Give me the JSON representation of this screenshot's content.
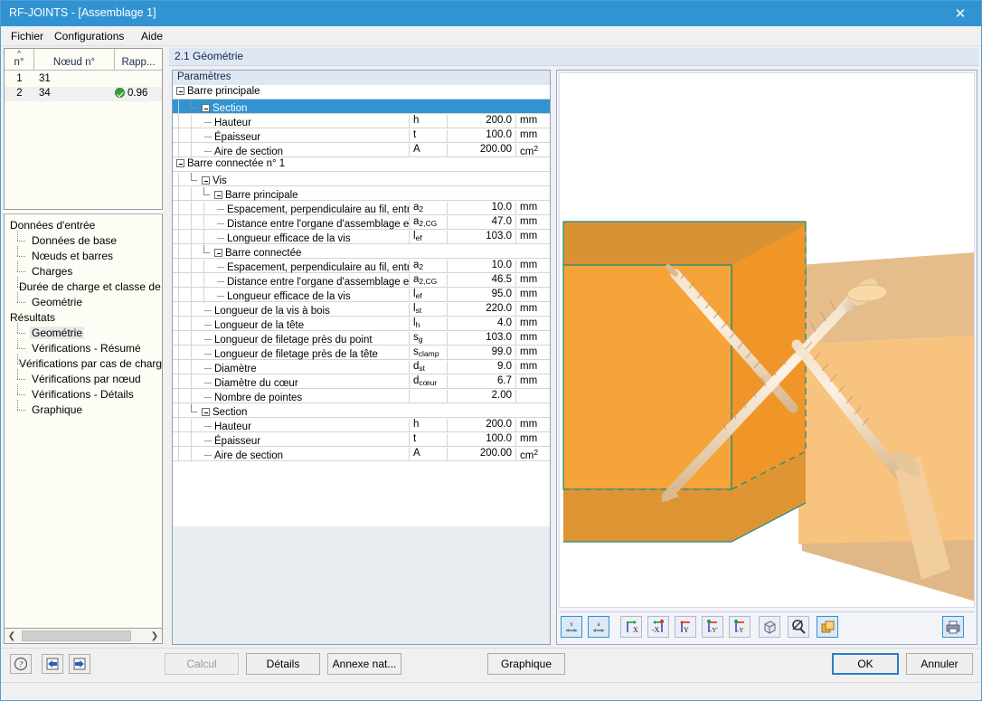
{
  "window": {
    "title": "RF-JOINTS - [Assemblage 1]",
    "close_icon": "close-icon",
    "titlebar_color": "#3193d2"
  },
  "menu": {
    "items": [
      {
        "label": "Fichier"
      },
      {
        "label": "Configurations"
      },
      {
        "label": "Aide"
      }
    ]
  },
  "grid": {
    "columns": [
      {
        "label": "n°"
      },
      {
        "label": "Nœud n°"
      },
      {
        "label": "Rapp..."
      }
    ],
    "rows": [
      {
        "n": "1",
        "node": "31",
        "ratio": "",
        "has_check": false
      },
      {
        "n": "2",
        "node": "34",
        "ratio": "0.96",
        "has_check": true
      }
    ]
  },
  "tree": {
    "sections": [
      {
        "label": "Données d'entrée",
        "items": [
          {
            "label": "Données de base"
          },
          {
            "label": "Nœuds et barres"
          },
          {
            "label": "Charges"
          },
          {
            "label": "Durée de charge et classe de s"
          },
          {
            "label": "Geométrie"
          }
        ]
      },
      {
        "label": "Résultats",
        "items": [
          {
            "label": "Geométrie",
            "selected": true
          },
          {
            "label": "Vérifications - Résumé"
          },
          {
            "label": "Vérifications par cas de charge"
          },
          {
            "label": "Vérifications par nœud"
          },
          {
            "label": "Vérifications - Détails"
          },
          {
            "label": "Graphique"
          }
        ]
      }
    ]
  },
  "section_header": {
    "title": "2.1 Géométrie"
  },
  "params": {
    "header": "Paramètres",
    "rows": [
      {
        "type": "group",
        "depth": 0,
        "label": "Barre principale",
        "expander": true
      },
      {
        "type": "group",
        "depth": 1,
        "label": "Section",
        "expander": true,
        "selected": true
      },
      {
        "type": "row",
        "depth": 2,
        "label": "Hauteur",
        "sym": "h",
        "sym_sub": "",
        "value": "200.0",
        "unit": "mm",
        "unit_sup": ""
      },
      {
        "type": "row",
        "depth": 2,
        "label": "Épaisseur",
        "sym": "t",
        "sym_sub": "",
        "value": "100.0",
        "unit": "mm",
        "unit_sup": ""
      },
      {
        "type": "row",
        "depth": 2,
        "label": "Aire de section",
        "sym": "A",
        "sym_sub": "",
        "value": "200.00",
        "unit": "cm",
        "unit_sup": "2"
      },
      {
        "type": "group",
        "depth": 0,
        "label": "Barre connectée n° 1",
        "expander": true
      },
      {
        "type": "group",
        "depth": 1,
        "label": "Vis",
        "expander": true
      },
      {
        "type": "group",
        "depth": 2,
        "label": "Barre principale",
        "expander": true
      },
      {
        "type": "row",
        "depth": 3,
        "label": "Espacement, perpendiculaire au fil, entre les",
        "sym": "a",
        "sym_sub": "2",
        "value": "10.0",
        "unit": "mm",
        "unit_sup": ""
      },
      {
        "type": "row",
        "depth": 3,
        "label": "Distance entre l'organe d'assemblage et le b",
        "sym": "a",
        "sym_sub": "2,CG",
        "value": "47.0",
        "unit": "mm",
        "unit_sup": ""
      },
      {
        "type": "row",
        "depth": 3,
        "label": "Longueur efficace de la vis",
        "sym": "l",
        "sym_sub": "ef",
        "value": "103.0",
        "unit": "mm",
        "unit_sup": ""
      },
      {
        "type": "group",
        "depth": 2,
        "label": "Barre connectée",
        "expander": true
      },
      {
        "type": "row",
        "depth": 3,
        "label": "Espacement, perpendiculaire au fil, entre les",
        "sym": "a",
        "sym_sub": "2",
        "value": "10.0",
        "unit": "mm",
        "unit_sup": ""
      },
      {
        "type": "row",
        "depth": 3,
        "label": "Distance entre l'organe d'assemblage et le b",
        "sym": "a",
        "sym_sub": "2,CG",
        "value": "46.5",
        "unit": "mm",
        "unit_sup": ""
      },
      {
        "type": "row",
        "depth": 3,
        "label": "Longueur efficace de la vis",
        "sym": "l",
        "sym_sub": "ef",
        "value": "95.0",
        "unit": "mm",
        "unit_sup": ""
      },
      {
        "type": "row",
        "depth": 2,
        "label": "Longueur de la vis à bois",
        "sym": "l",
        "sym_sub": "st",
        "value": "220.0",
        "unit": "mm",
        "unit_sup": ""
      },
      {
        "type": "row",
        "depth": 2,
        "label": "Longueur de la tête",
        "sym": "l",
        "sym_sub": "h",
        "value": "4.0",
        "unit": "mm",
        "unit_sup": ""
      },
      {
        "type": "row",
        "depth": 2,
        "label": "Longueur de filetage près du point",
        "sym": "s",
        "sym_sub": "g",
        "value": "103.0",
        "unit": "mm",
        "unit_sup": ""
      },
      {
        "type": "row",
        "depth": 2,
        "label": "Longueur de filetage près de la tête",
        "sym": "s",
        "sym_sub": "clamp",
        "value": "99.0",
        "unit": "mm",
        "unit_sup": ""
      },
      {
        "type": "row",
        "depth": 2,
        "label": "Diamètre",
        "sym": "d",
        "sym_sub": "st",
        "value": "9.0",
        "unit": "mm",
        "unit_sup": ""
      },
      {
        "type": "row",
        "depth": 2,
        "label": "Diamètre du cœur",
        "sym": "d",
        "sym_sub": "cœur",
        "value": "6.7",
        "unit": "mm",
        "unit_sup": ""
      },
      {
        "type": "row",
        "depth": 2,
        "label": "Nombre de pointes",
        "sym": "",
        "sym_sub": "",
        "value": "2.00",
        "unit": "",
        "unit_sup": ""
      },
      {
        "type": "group",
        "depth": 1,
        "label": "Section",
        "expander": true
      },
      {
        "type": "row",
        "depth": 2,
        "label": "Hauteur",
        "sym": "h",
        "sym_sub": "",
        "value": "200.0",
        "unit": "mm",
        "unit_sup": ""
      },
      {
        "type": "row",
        "depth": 2,
        "label": "Épaisseur",
        "sym": "t",
        "sym_sub": "",
        "value": "100.0",
        "unit": "mm",
        "unit_sup": ""
      },
      {
        "type": "row",
        "depth": 2,
        "label": "Aire de section",
        "sym": "A",
        "sym_sub": "",
        "value": "200.00",
        "unit": "cm",
        "unit_sup": "2"
      }
    ]
  },
  "viewport": {
    "toolbar": [
      {
        "name": "dimension-x-button",
        "glyph": "x",
        "style": "blue"
      },
      {
        "name": "dimension-a-button",
        "glyph": "a",
        "style": "blue"
      },
      {
        "name": "view-x-button",
        "glyph": "X",
        "style": "axis"
      },
      {
        "name": "view-minus-x-button",
        "glyph": "-X",
        "style": "axis"
      },
      {
        "name": "view-y-button",
        "glyph": "Y",
        "style": "axis"
      },
      {
        "name": "view-minus-y-prime-button",
        "glyph": "-Y'",
        "style": "axis"
      },
      {
        "name": "view-minus-y-button",
        "glyph": "-Y",
        "style": "axis"
      },
      {
        "name": "isometric-view-button",
        "glyph": "cube",
        "style": "plain"
      },
      {
        "name": "zoom-reset-button",
        "glyph": "zoom",
        "style": "plain"
      },
      {
        "name": "render-mode-button",
        "glyph": "layers",
        "style": "blue"
      },
      {
        "name": "print-graphic-button",
        "glyph": "printer",
        "style": "blue"
      }
    ],
    "colors": {
      "main_beam_front": "#f6a33a",
      "main_beam_top": "#d99233",
      "main_beam_side": "#f09527",
      "connected_beam": "#f8c37e",
      "connected_beam_top": "#e0b887",
      "edge_green": "#1b8c82",
      "screw": "#e8cba8"
    }
  },
  "bottombar": {
    "icon_buttons": [
      {
        "name": "help-button",
        "glyph": "?"
      },
      {
        "name": "previous-button",
        "glyph": "left-arrow"
      },
      {
        "name": "next-button",
        "glyph": "right-arrow"
      }
    ],
    "buttons": [
      {
        "label": "Calcul",
        "disabled": true
      },
      {
        "label": "Détails",
        "disabled": false
      },
      {
        "label": "Annexe nat...",
        "disabled": false
      },
      {
        "label": "Graphique",
        "disabled": false
      },
      {
        "label": "OK",
        "disabled": false,
        "primary": true
      },
      {
        "label": "Annuler",
        "disabled": false
      }
    ]
  }
}
